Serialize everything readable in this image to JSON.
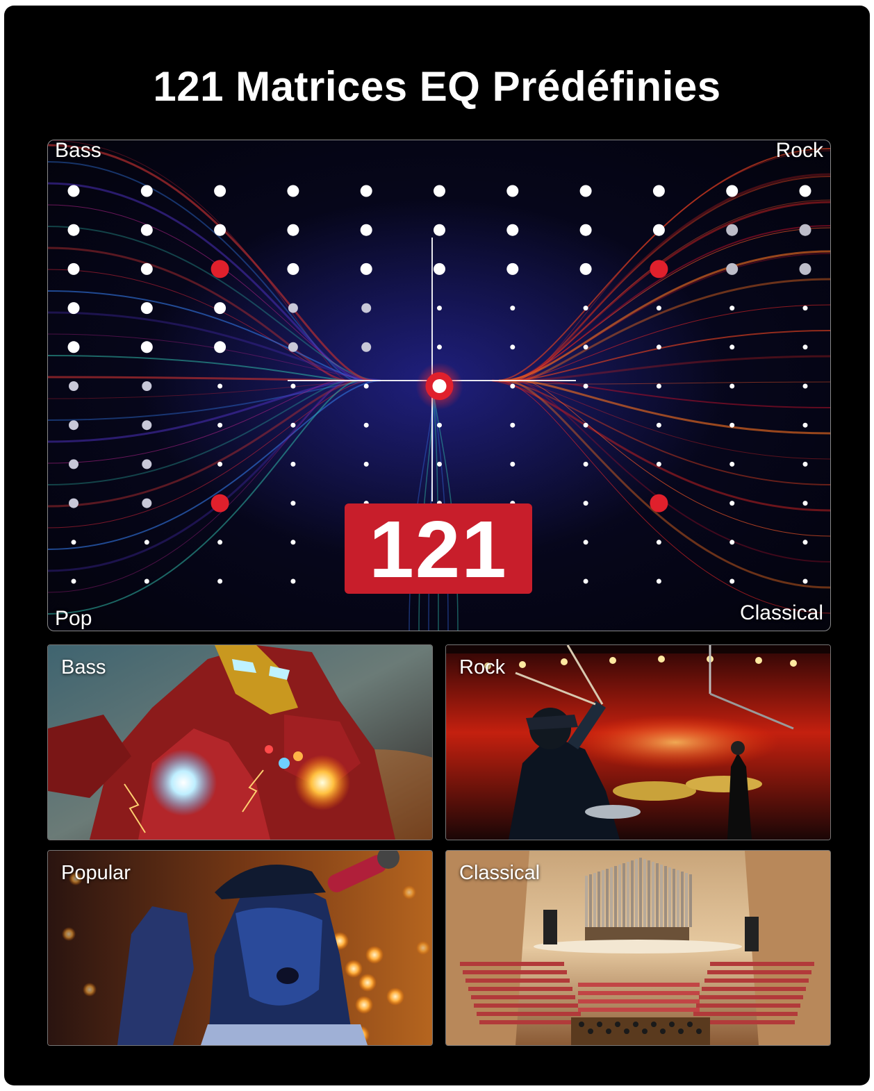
{
  "title": "121 Matrices EQ Prédéfinies",
  "matrix": {
    "corners": {
      "top_left": "Bass",
      "top_right": "Rock",
      "bottom_left": "Pop",
      "bottom_right": "Classical"
    },
    "count": "121",
    "grid_size": 11,
    "highlight_points": [
      [
        2,
        2
      ],
      [
        8,
        2
      ],
      [
        2,
        8
      ],
      [
        8,
        8
      ]
    ],
    "center_point": [
      5,
      5
    ],
    "accent_color": "#e0202c"
  },
  "tiles": [
    {
      "label": "Bass",
      "scene": "armored-hero-illustration"
    },
    {
      "label": "Rock",
      "scene": "concert-drummer-photo"
    },
    {
      "label": "Popular",
      "scene": "singer-with-microphone-photo"
    },
    {
      "label": "Classical",
      "scene": "concert-hall-organ-photo"
    }
  ]
}
